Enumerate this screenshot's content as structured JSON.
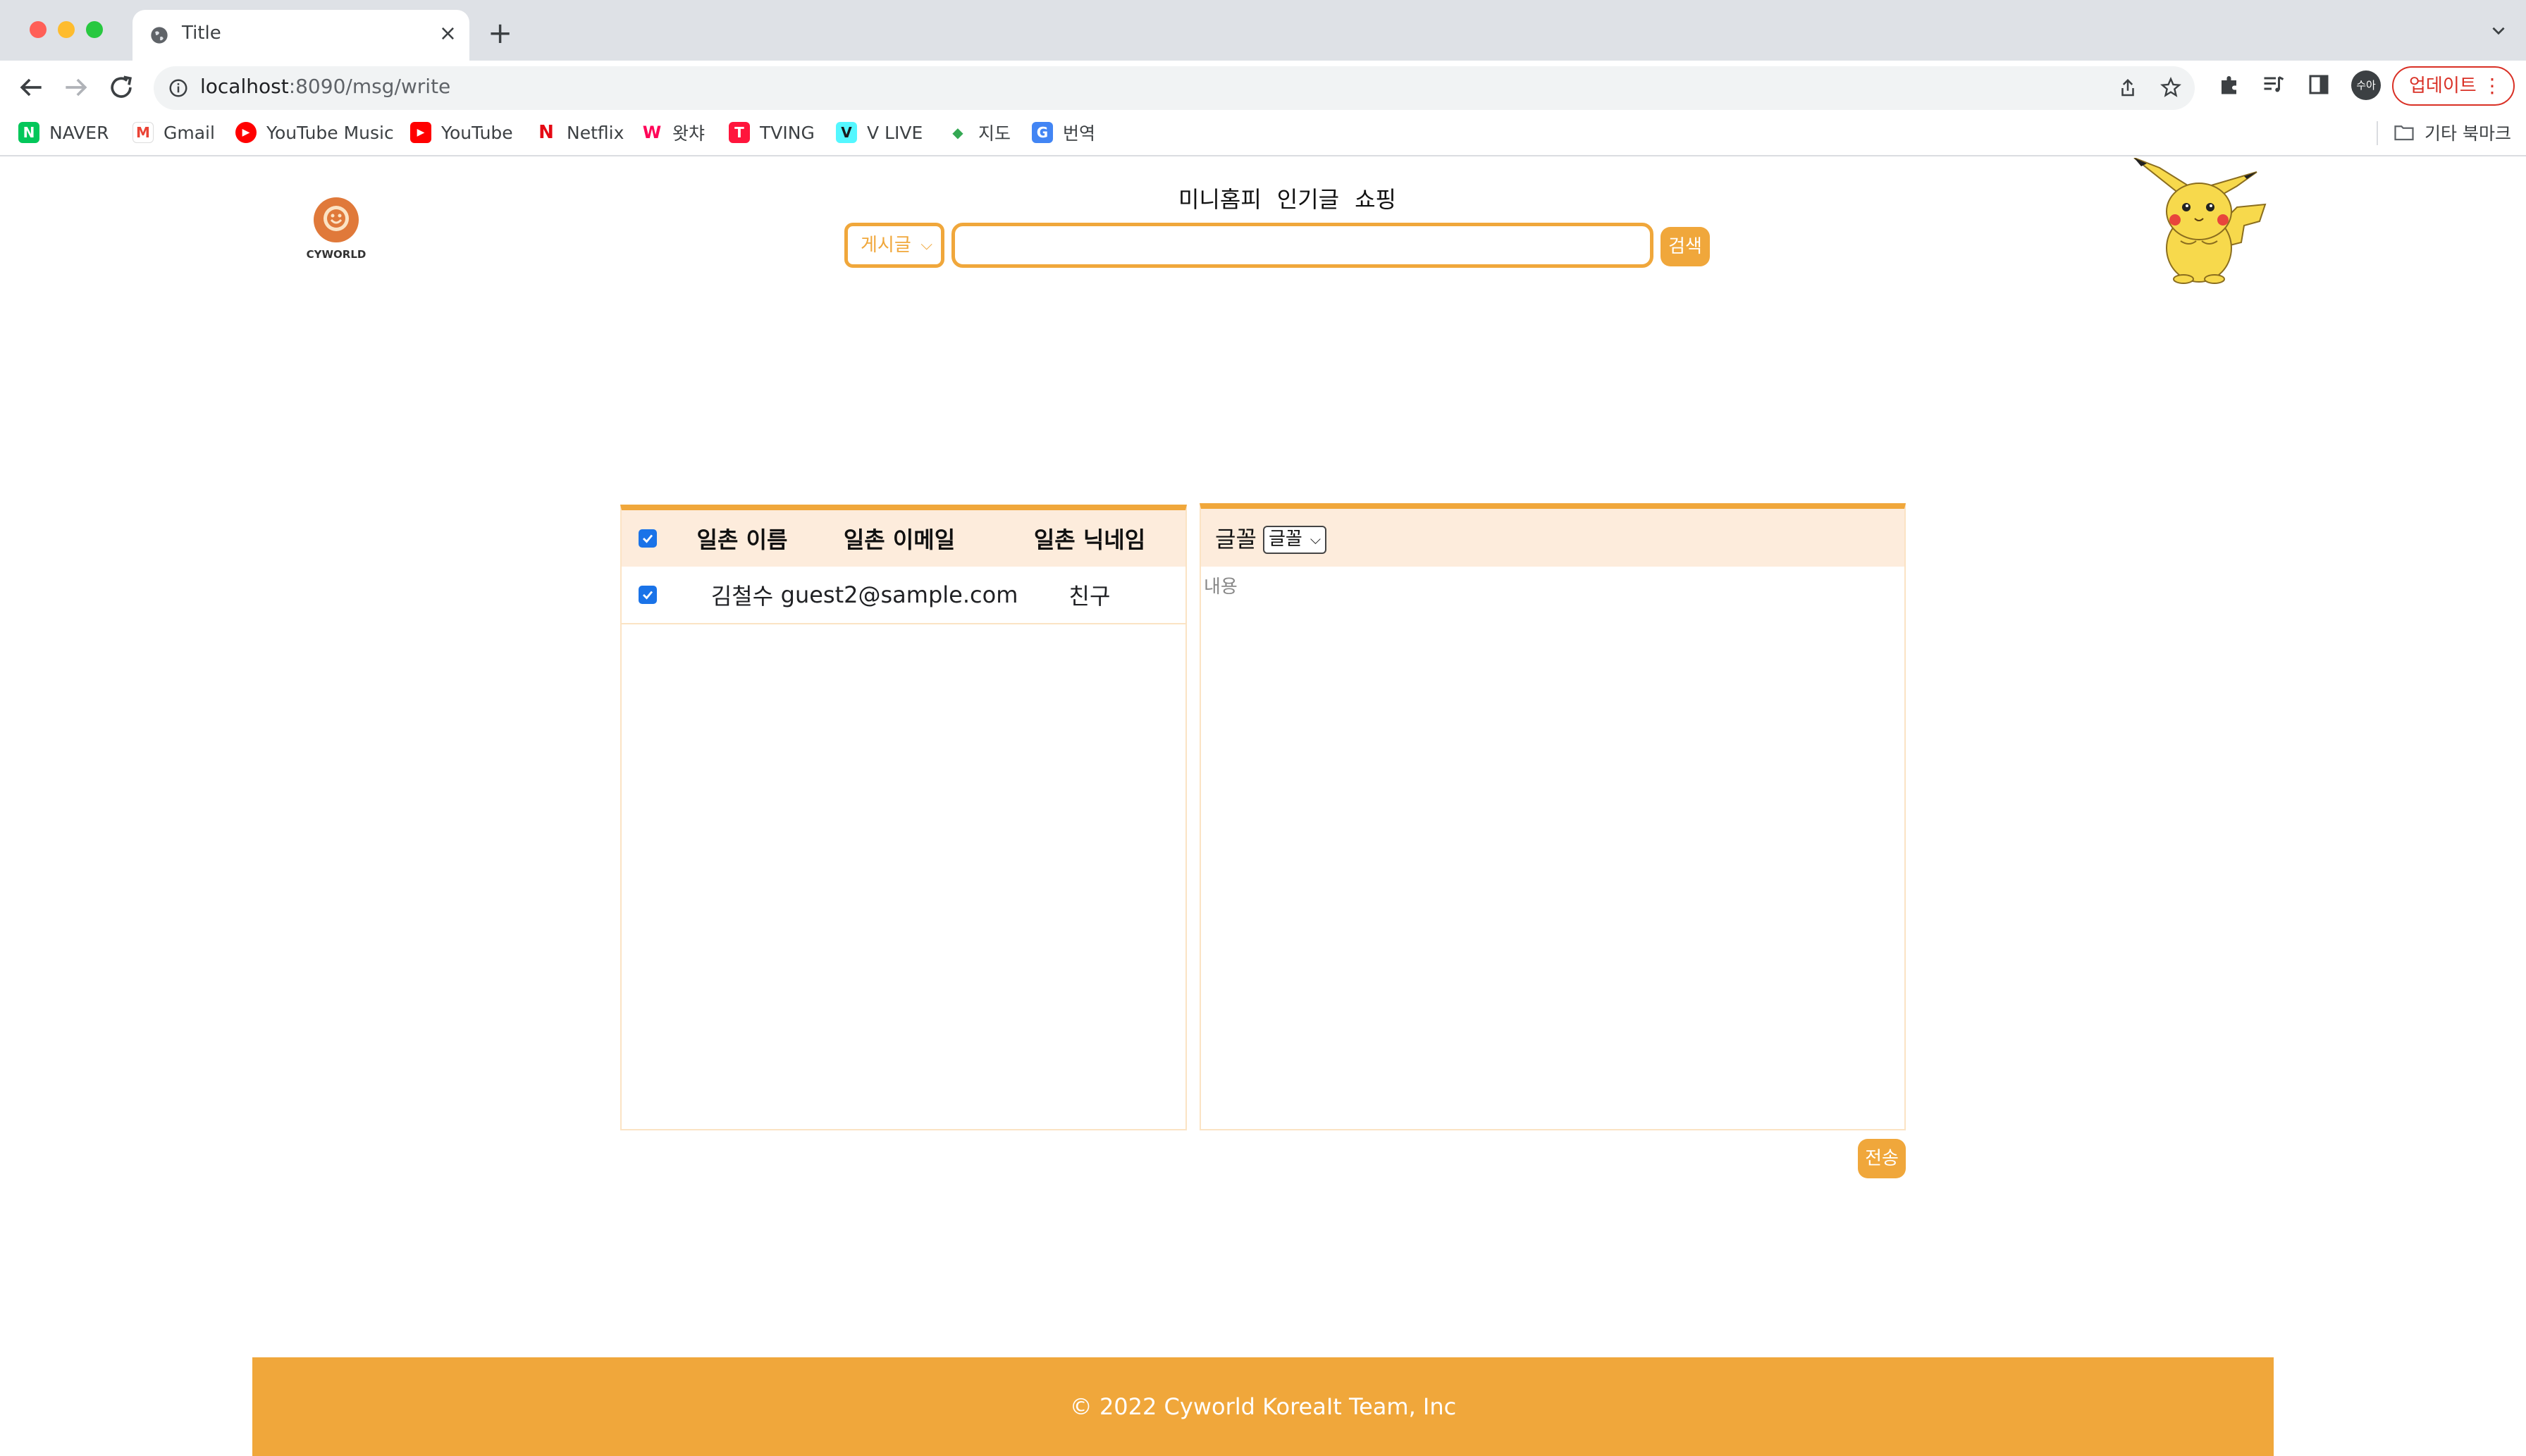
{
  "browser": {
    "tab_title": "Title",
    "tab_close": "×",
    "new_tab": "+",
    "url_host": "localhost",
    "url_rest": ":8090/msg/write",
    "profile_initials": "수아",
    "update_label": "업데이트",
    "update_menu": "⋮",
    "bookmarks": [
      {
        "label": "NAVER",
        "icon": "naver-icon",
        "glyph": "N",
        "color": "#03c75a"
      },
      {
        "label": "Gmail",
        "icon": "gmail-icon",
        "glyph": "M",
        "color": "#ea4335"
      },
      {
        "label": "YouTube Music",
        "icon": "youtube-music-icon",
        "glyph": "▶",
        "color": "#ff0000"
      },
      {
        "label": "YouTube",
        "icon": "youtube-icon",
        "glyph": "▶",
        "color": "#ff0000"
      },
      {
        "label": "Netflix",
        "icon": "netflix-icon",
        "glyph": "N",
        "color": "#e50914"
      },
      {
        "label": "왓챠",
        "icon": "watcha-icon",
        "glyph": "W",
        "color": "#ff0558"
      },
      {
        "label": "TVING",
        "icon": "tving-icon",
        "glyph": "T",
        "color": "#ff153c"
      },
      {
        "label": "V LIVE",
        "icon": "vlive-icon",
        "glyph": "V",
        "color": "#54f7ff"
      },
      {
        "label": "지도",
        "icon": "maps-icon",
        "glyph": "◆",
        "color": "#34a853"
      },
      {
        "label": "번역",
        "icon": "translate-icon",
        "glyph": "G",
        "color": "#4285f4"
      }
    ],
    "other_bookmarks": "기타 북마크"
  },
  "header": {
    "logo_text": "CYWORLD",
    "nav": [
      "미니홈피",
      "인기글",
      "쇼핑"
    ],
    "search_category": "게시글",
    "search_value": "",
    "search_button": "검색"
  },
  "friends": {
    "headers": [
      "일촌 이름",
      "일촌 이메일",
      "일촌 닉네임"
    ],
    "header_checked": true,
    "rows": [
      {
        "checked": true,
        "name": "김철수",
        "email": "guest2@sample.com",
        "nickname": "친구"
      }
    ]
  },
  "message": {
    "font_label": "글꼴",
    "font_select": "글꼴",
    "placeholder": "내용",
    "send_button": "전송"
  },
  "footer": {
    "text": "© 2022 Cyworld KoreaIt Team, Inc"
  },
  "colors": {
    "accent": "#f0a73b",
    "header_bg": "#fdecdc",
    "update_red": "#d93025"
  }
}
